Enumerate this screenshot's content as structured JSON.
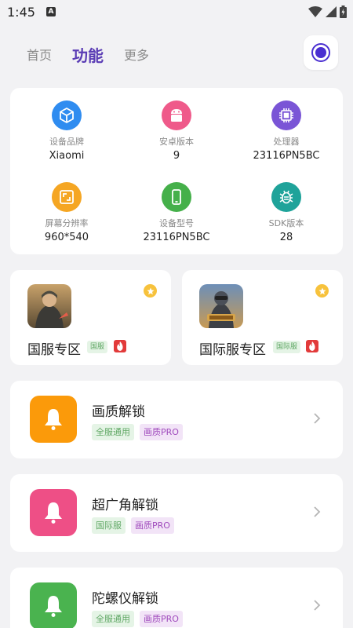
{
  "status": {
    "time": "1:45"
  },
  "tabs": [
    {
      "label": "首页"
    },
    {
      "label": "功能"
    },
    {
      "label": "更多"
    }
  ],
  "device_info": [
    {
      "label": "设备品牌",
      "value": "Xiaomi",
      "icon": "cube-icon",
      "color": "#2f8cf0"
    },
    {
      "label": "安卓版本",
      "value": "9",
      "icon": "android-icon",
      "color": "#ef5a8a"
    },
    {
      "label": "处理器",
      "value": "23116PN5BC",
      "icon": "chip-icon",
      "color": "#7a55d6"
    },
    {
      "label": "屏幕分辨率",
      "value": "960*540",
      "icon": "screen-resolution-icon",
      "color": "#f5a623"
    },
    {
      "label": "设备型号",
      "value": "23116PN5BC",
      "icon": "phone-icon",
      "color": "#45b04a"
    },
    {
      "label": "SDK版本",
      "value": "28",
      "icon": "sdk-bug-icon",
      "color": "#1fa39a"
    }
  ],
  "servers": [
    {
      "name": "国服专区",
      "tag": "国服"
    },
    {
      "name": "国际服专区",
      "tag": "国际服"
    }
  ],
  "features": [
    {
      "title": "画质解锁",
      "tags": [
        "全服通用",
        "画质PRO"
      ],
      "color": "#fb9a0a"
    },
    {
      "title": "超广角解锁",
      "tags": [
        "国际服",
        "画质PRO"
      ],
      "color": "#ee4f86"
    },
    {
      "title": "陀螺仪解锁",
      "tags": [
        "全服通用",
        "画质PRO"
      ],
      "color": "#4ab34f"
    }
  ]
}
